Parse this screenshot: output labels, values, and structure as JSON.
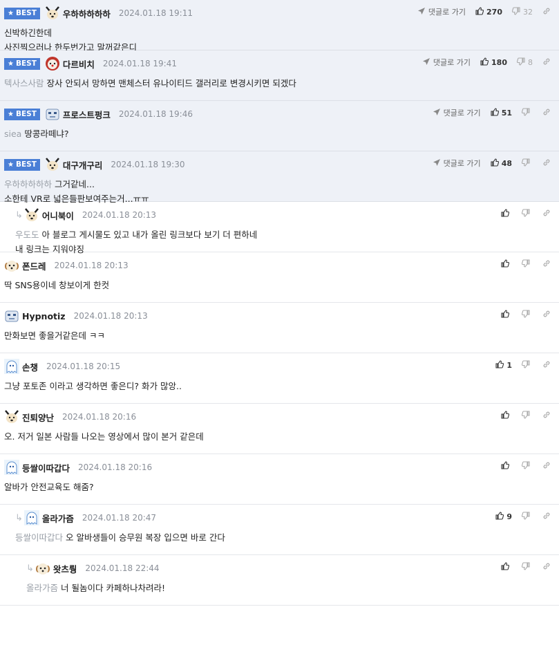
{
  "comments": [
    {
      "best": true,
      "badge": "BEST",
      "avatar": "dog",
      "name": "우하하하하하",
      "date": "2024.01.18 19:11",
      "mention": "",
      "lines": [
        "신박하긴한데",
        "사진찍으러나 한두번가고 말꺼같은디"
      ],
      "reply_label": "댓글로 가기",
      "up": "270",
      "down": "32",
      "level": 0
    },
    {
      "best": true,
      "badge": "BEST",
      "avatar": "clown",
      "name": "다르비치",
      "date": "2024.01.18 19:41",
      "mention": "텍사스사람",
      "lines": [
        "장사 안되서 망하면 맨체스터 유나이티드 갤러리로 변경시키면 되겠다"
      ],
      "reply_label": "댓글로 가기",
      "up": "180",
      "down": "8",
      "level": 0
    },
    {
      "best": true,
      "badge": "BEST",
      "avatar": "robot",
      "name": "프로스트펑크",
      "date": "2024.01.18 19:46",
      "mention": "siea",
      "lines": [
        "땅콩라떼냐?"
      ],
      "reply_label": "댓글로 가기",
      "up": "51",
      "down": "",
      "level": 0
    },
    {
      "best": true,
      "badge": "BEST",
      "avatar": "dog",
      "name": "대구개구리",
      "date": "2024.01.18 19:30",
      "mention": "우하하하하하",
      "lines": [
        "그거같네...",
        "소한테 VR로 넓은들판보여주는거...ㅠㅠ"
      ],
      "reply_label": "댓글로 가기",
      "up": "48",
      "down": "",
      "level": 0
    },
    {
      "best": false,
      "avatar": "dog",
      "name": "어니북이",
      "date": "2024.01.18 20:13",
      "mention": "우도도",
      "lines": [
        "아 블로그 게시물도 있고 내가 올린 링크보다 보기 더 편하네",
        "내 링크는 지워야징"
      ],
      "up": "",
      "down": "",
      "level": 1
    },
    {
      "best": false,
      "avatar": "pup",
      "name": "폰드레",
      "date": "2024.01.18 20:13",
      "mention": "",
      "lines": [
        "딱 SNS용이네 창보이게 한컷"
      ],
      "up": "",
      "down": "",
      "level": 0
    },
    {
      "best": false,
      "avatar": "robot",
      "name": "Hypnotiz",
      "date": "2024.01.18 20:13",
      "mention": "",
      "lines": [
        "만화보면 좋을거같은데 ㅋㅋ"
      ],
      "up": "",
      "down": "",
      "level": 0
    },
    {
      "best": false,
      "avatar": "ghost",
      "name": "손챙",
      "date": "2024.01.18 20:15",
      "mention": "",
      "lines": [
        "그냥 포토존 이라고 생각하면 좋은디? 화가 많앙.."
      ],
      "up": "1",
      "down": "",
      "level": 0
    },
    {
      "best": false,
      "avatar": "dog",
      "name": "진퇴양난",
      "date": "2024.01.18 20:16",
      "mention": "",
      "lines": [
        "오. 저거 일본 사람들 나오는 영상에서 많이 본거 같은데"
      ],
      "up": "",
      "down": "",
      "level": 0
    },
    {
      "best": false,
      "avatar": "ghost",
      "name": "등쌀이따갑다",
      "date": "2024.01.18 20:16",
      "mention": "",
      "lines": [
        "알바가 안전교육도 해줌?"
      ],
      "up": "",
      "down": "",
      "level": 0
    },
    {
      "best": false,
      "avatar": "ghost",
      "name": "올라가즘",
      "date": "2024.01.18 20:47",
      "mention": "등쌀이따갑다",
      "lines": [
        "오 알바생들이 승무원 복장 입으면 바로 간다"
      ],
      "up": "9",
      "down": "",
      "level": 1
    },
    {
      "best": false,
      "avatar": "pup",
      "name": "왓츠뤙",
      "date": "2024.01.18 22:44",
      "mention": "올라가즘",
      "lines": [
        "너 될놈이다 카페하나차려라!"
      ],
      "up": "",
      "down": "",
      "level": 2
    }
  ],
  "colors": {
    "best_bg": "#eef1f7",
    "badge": "#4a7fd6",
    "mention": "#9aa0a8",
    "date": "#8a8f98"
  }
}
